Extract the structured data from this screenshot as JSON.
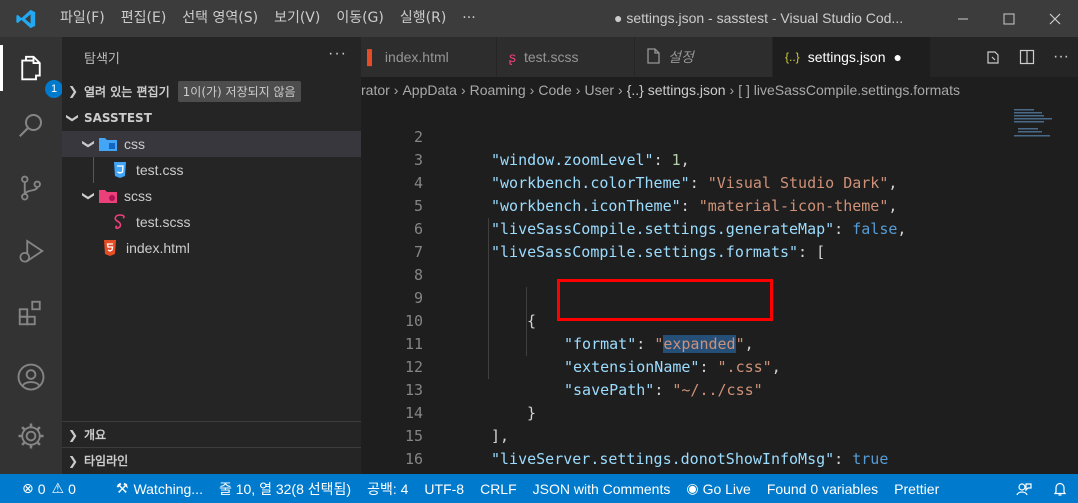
{
  "titlebar": {
    "menu": [
      "파일(F)",
      "편집(E)",
      "선택 영역(S)",
      "보기(V)",
      "이동(G)",
      "실행(R)",
      "···"
    ],
    "title": "● settings.json - sasstest - Visual Studio Cod..."
  },
  "activity": {
    "badge": "1"
  },
  "sidebar": {
    "header": "탐색기",
    "more": "···",
    "open_editors": "열려 있는 편집기",
    "unsaved_badge": "1이(가) 저장되지 않음",
    "project": "SASSTEST",
    "tree": [
      {
        "label": "css"
      },
      {
        "label": "test.css"
      },
      {
        "label": "scss"
      },
      {
        "label": "test.scss"
      },
      {
        "label": "index.html"
      }
    ],
    "outline": "개요",
    "timeline": "타임라인"
  },
  "tabs": [
    {
      "label": "index.html",
      "icon": "html-icon"
    },
    {
      "label": "test.scss",
      "icon": "sass-icon"
    },
    {
      "label": "설정",
      "icon": "settings-file-icon"
    },
    {
      "label": "settings.json",
      "icon": "json-icon"
    }
  ],
  "breadcrumb": [
    "rator",
    "AppData",
    "Roaming",
    "Code",
    "User",
    "{..} settings.json",
    "[ ] liveSassCompile.settings.formats"
  ],
  "editor": {
    "lines": [
      {
        "n": "2"
      },
      {
        "n": "3"
      },
      {
        "n": "4"
      },
      {
        "n": "5"
      },
      {
        "n": "6"
      },
      {
        "n": "7"
      },
      {
        "n": "8"
      },
      {
        "n": "9"
      },
      {
        "n": "10"
      },
      {
        "n": "11"
      },
      {
        "n": "12"
      },
      {
        "n": "13"
      },
      {
        "n": "14"
      },
      {
        "n": "15"
      },
      {
        "n": "16"
      }
    ],
    "tokens": {
      "l2k": "\"window.zoomLevel\"",
      "l2v": "1",
      "l3k": "\"workbench.colorTheme\"",
      "l3v": "\"Visual Studio Dark\"",
      "l4k": "\"workbench.iconTheme\"",
      "l4v": "\"material-icon-theme\"",
      "l5k": "\"liveSassCompile.settings.generateMap\"",
      "l5v": "false",
      "l6k": "\"liveSassCompile.settings.formats\"",
      "l6v": "[",
      "l9": "{",
      "l10k": "\"format\"",
      "l10q": "\"",
      "l10v": "expanded",
      "l10e": "\"",
      "l11k": "\"extensionName\"",
      "l11v": "\".css\"",
      "l12k": "\"savePath\"",
      "l12v": "\"~/../css\"",
      "l13": "}",
      "l14": "],",
      "l15k": "\"liveServer.settings.donotShowInfoMsg\"",
      "l15v": "true",
      "l16": "}"
    }
  },
  "status": {
    "errors": "0",
    "warnings": "0",
    "watching": "Watching...",
    "position": "줄 10, 열 32(8 선택됨)",
    "spaces": "공백: 4",
    "encoding": "UTF-8",
    "eol": "CRLF",
    "language": "JSON with Comments",
    "golive": "Go Live",
    "found": "Found 0 variables",
    "prettier": "Prettier"
  },
  "colors": {
    "accent": "#007acc",
    "key": "#9cdcfe",
    "string": "#ce9178",
    "number": "#b5cea8",
    "keyword": "#569cd6",
    "highlight": "#ff0000"
  }
}
